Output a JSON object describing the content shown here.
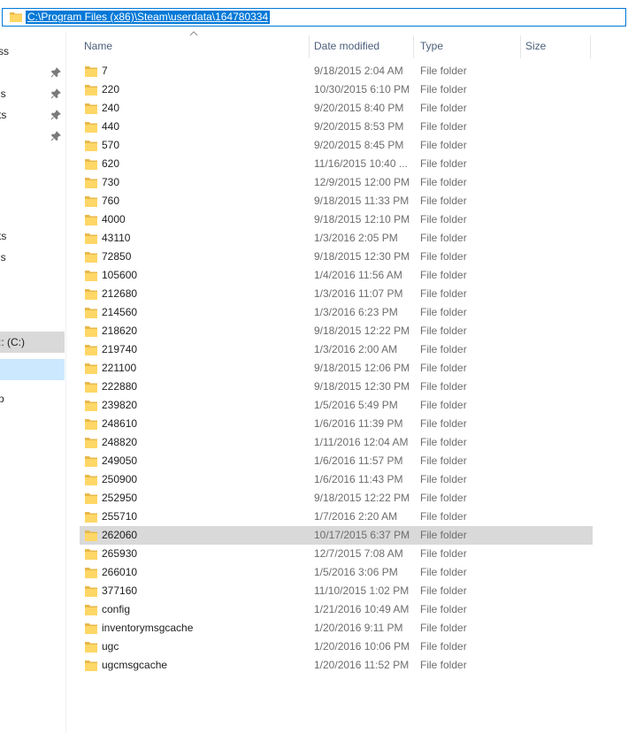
{
  "address_bar": {
    "path": "C:\\Program Files (x86)\\Steam\\userdata\\164780334"
  },
  "nav_pane": {
    "items": [
      {
        "label": "ss",
        "pinned": false
      },
      {
        "label": "",
        "pinned": true
      },
      {
        "label": "ls",
        "pinned": true
      },
      {
        "label": "ts",
        "pinned": true
      },
      {
        "label": "",
        "pinned": true
      },
      {
        "label": "ts",
        "pinned": false
      },
      {
        "label": "ls",
        "pinned": false
      },
      {
        "label": ":: (C:)",
        "pinned": false
      },
      {
        "label": "",
        "pinned": false
      },
      {
        "label": "p",
        "pinned": false
      }
    ]
  },
  "columns": {
    "name": "Name",
    "date_modified": "Date modified",
    "type": "Type",
    "size": "Size"
  },
  "files": [
    {
      "name": "7",
      "date": "9/18/2015 2:04 AM",
      "type": "File folder"
    },
    {
      "name": "220",
      "date": "10/30/2015 6:10 PM",
      "type": "File folder"
    },
    {
      "name": "240",
      "date": "9/20/2015 8:40 PM",
      "type": "File folder"
    },
    {
      "name": "440",
      "date": "9/20/2015 8:53 PM",
      "type": "File folder"
    },
    {
      "name": "570",
      "date": "9/20/2015 8:45 PM",
      "type": "File folder"
    },
    {
      "name": "620",
      "date": "11/16/2015 10:40 ...",
      "type": "File folder"
    },
    {
      "name": "730",
      "date": "12/9/2015 12:00 PM",
      "type": "File folder"
    },
    {
      "name": "760",
      "date": "9/18/2015 11:33 PM",
      "type": "File folder"
    },
    {
      "name": "4000",
      "date": "9/18/2015 12:10 PM",
      "type": "File folder"
    },
    {
      "name": "43110",
      "date": "1/3/2016 2:05 PM",
      "type": "File folder"
    },
    {
      "name": "72850",
      "date": "9/18/2015 12:30 PM",
      "type": "File folder"
    },
    {
      "name": "105600",
      "date": "1/4/2016 11:56 AM",
      "type": "File folder"
    },
    {
      "name": "212680",
      "date": "1/3/2016 11:07 PM",
      "type": "File folder"
    },
    {
      "name": "214560",
      "date": "1/3/2016 6:23 PM",
      "type": "File folder"
    },
    {
      "name": "218620",
      "date": "9/18/2015 12:22 PM",
      "type": "File folder"
    },
    {
      "name": "219740",
      "date": "1/3/2016 2:00 AM",
      "type": "File folder"
    },
    {
      "name": "221100",
      "date": "9/18/2015 12:06 PM",
      "type": "File folder"
    },
    {
      "name": "222880",
      "date": "9/18/2015 12:30 PM",
      "type": "File folder"
    },
    {
      "name": "239820",
      "date": "1/5/2016 5:49 PM",
      "type": "File folder"
    },
    {
      "name": "248610",
      "date": "1/6/2016 11:39 PM",
      "type": "File folder"
    },
    {
      "name": "248820",
      "date": "1/11/2016 12:04 AM",
      "type": "File folder"
    },
    {
      "name": "249050",
      "date": "1/6/2016 11:57 PM",
      "type": "File folder"
    },
    {
      "name": "250900",
      "date": "1/6/2016 11:43 PM",
      "type": "File folder"
    },
    {
      "name": "252950",
      "date": "9/18/2015 12:22 PM",
      "type": "File folder"
    },
    {
      "name": "255710",
      "date": "1/7/2016 2:20 AM",
      "type": "File folder"
    },
    {
      "name": "262060",
      "date": "10/17/2015 6:37 PM",
      "type": "File folder",
      "selected": true
    },
    {
      "name": "265930",
      "date": "12/7/2015 7:08 AM",
      "type": "File folder"
    },
    {
      "name": "266010",
      "date": "1/5/2016 3:06 PM",
      "type": "File folder"
    },
    {
      "name": "377160",
      "date": "11/10/2015 1:02 PM",
      "type": "File folder"
    },
    {
      "name": "config",
      "date": "1/21/2016 10:49 AM",
      "type": "File folder"
    },
    {
      "name": "inventorymsgcache",
      "date": "1/20/2016 9:11 PM",
      "type": "File folder"
    },
    {
      "name": "ugc",
      "date": "1/20/2016 10:06 PM",
      "type": "File folder"
    },
    {
      "name": "ugcmsgcache",
      "date": "1/20/2016 11:52 PM",
      "type": "File folder"
    }
  ],
  "colors": {
    "accent": "#0078d7",
    "selection": "#d9d9d9",
    "nav_selected": "#cce8ff",
    "folder": "#ffd766"
  },
  "icons": {
    "folder": "folder-icon",
    "pin": "pin-icon",
    "sort": "sort-ascending-icon"
  }
}
